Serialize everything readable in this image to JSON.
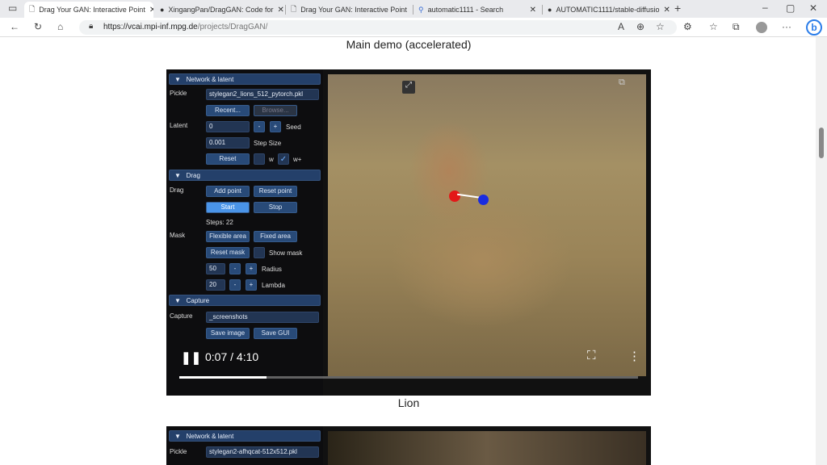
{
  "browser": {
    "tabs": [
      {
        "label": "Drag Your GAN: Interactive Point",
        "icon": "page-icon",
        "active": true
      },
      {
        "label": "XingangPan/DragGAN: Code for",
        "icon": "github-icon"
      },
      {
        "label": "Drag Your GAN: Interactive Point",
        "icon": "page-icon"
      },
      {
        "label": "automatic1111 - Search",
        "icon": "search-icon"
      },
      {
        "label": "AUTOMATIC1111/stable-diffusio",
        "icon": "github-icon"
      }
    ],
    "url_host": "https://vcai.mpi-inf.mpg.de",
    "url_path": "/projects/DragGAN/"
  },
  "page": {
    "demo_title": "Main demo (accelerated)",
    "caption": "Lion",
    "video": {
      "time": "0:07 / 4:10",
      "progress": 0.19
    },
    "gui": {
      "network_header": "Network & latent",
      "pickle_label": "Pickle",
      "pickle_value": "stylegan2_lions_512_pytorch.pkl",
      "recent": "Recent...",
      "browse": "Browse...",
      "latent_label": "Latent",
      "latent_value": "0",
      "minus": "-",
      "plus": "+",
      "seed": "Seed",
      "step_value": "0.001",
      "step_size": "Step Size",
      "reset": "Reset",
      "w": "w",
      "wplus": "w+",
      "check": "✓",
      "drag_header": "Drag",
      "drag_label": "Drag",
      "add_point": "Add point",
      "reset_point": "Reset point",
      "start": "Start",
      "stop": "Stop",
      "steps": "Steps: 22",
      "mask_label": "Mask",
      "flexible": "Flexible area",
      "fixed": "Fixed area",
      "reset_mask": "Reset mask",
      "show_mask": "Show mask",
      "radius_value": "50",
      "radius": "Radius",
      "lambda_value": "20",
      "lambda": "Lambda",
      "capture_header": "Capture",
      "capture_label": "Capture",
      "capture_value": "_screenshots",
      "save_image": "Save image",
      "save_gui": "Save GUI"
    },
    "second_gui": {
      "network_header": "Network & latent",
      "pickle_label": "Pickle",
      "pickle_value": "stylegan2-afhqcat-512x512.pkl"
    }
  }
}
